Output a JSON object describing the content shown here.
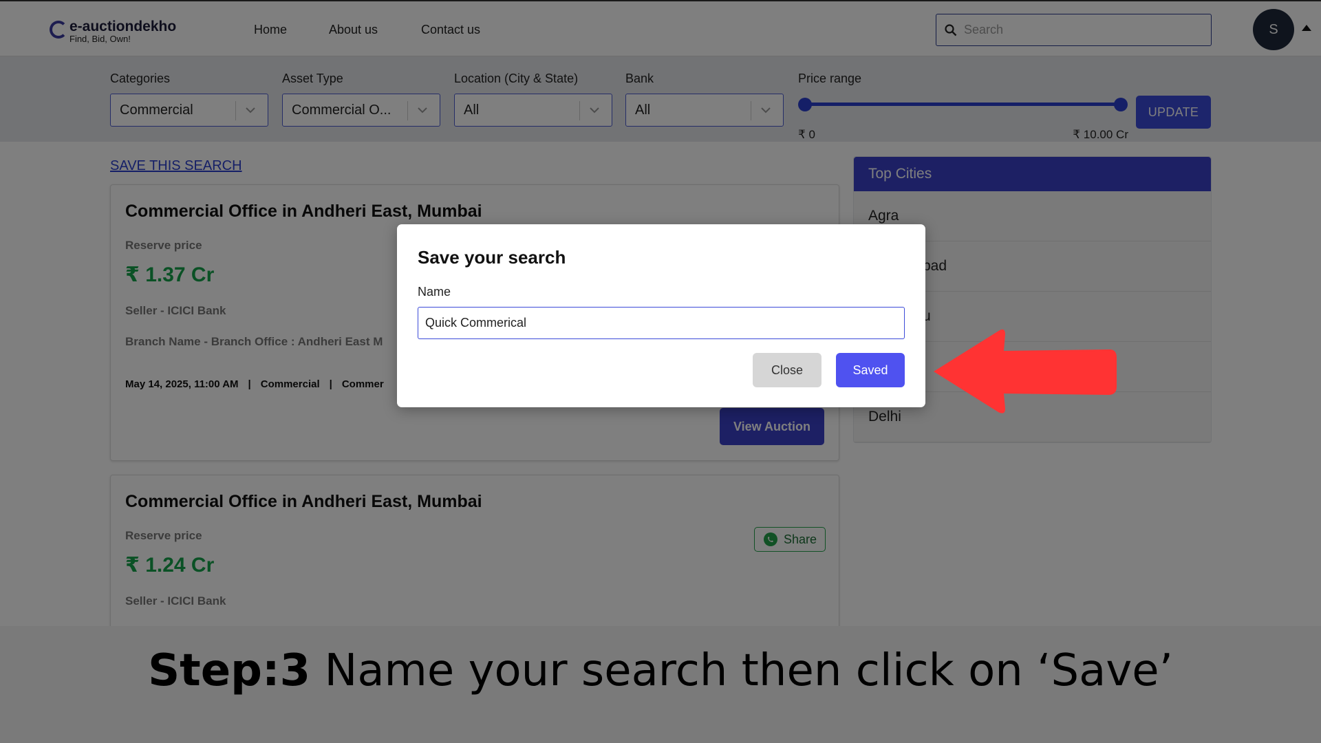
{
  "brand": {
    "name": "e-auctiondekho",
    "tagline": "Find, Bid, Own!"
  },
  "nav": {
    "links": [
      "Home",
      "About us",
      "Contact us"
    ]
  },
  "search": {
    "placeholder": "Search"
  },
  "user": {
    "initial": "S"
  },
  "filters": {
    "categories": {
      "label": "Categories",
      "value": "Commercial"
    },
    "asset_type": {
      "label": "Asset Type",
      "value": "Commercial O..."
    },
    "location": {
      "label": "Location (City & State)",
      "value": "All"
    },
    "bank": {
      "label": "Bank",
      "value": "All"
    },
    "price_range": {
      "label": "Price range",
      "min": "₹ 0",
      "max": "₹ 10.00 Cr",
      "min_fraction": 0,
      "max_fraction": 1
    },
    "update_label": "UPDATE"
  },
  "save_search_link": "SAVE THIS SEARCH",
  "listings": [
    {
      "title": "Commercial Office in Andheri East, Mumbai",
      "reserve_label": "Reserve price",
      "price": "₹ 1.37 Cr",
      "seller": "Seller -  ICICI Bank",
      "branch": "Branch Name -  Branch Office : Andheri East M",
      "date": "May 14, 2025, 11:00 AM",
      "category": "Commercial",
      "asset": "Commer",
      "view_label": "View Auction"
    },
    {
      "title": "Commercial Office in Andheri East, Mumbai",
      "reserve_label": "Reserve price",
      "price": "₹ 1.24 Cr",
      "seller": "Seller -  ICICI Bank",
      "share_label": "Share"
    }
  ],
  "top_cities": {
    "title": "Top Cities",
    "items": [
      "Agra",
      "bad",
      "u",
      "",
      "Delhi"
    ]
  },
  "modal": {
    "title": "Save your search",
    "name_label": "Name",
    "name_value": "Quick Commerical",
    "close_label": "Close",
    "saved_label": "Saved"
  },
  "caption": {
    "step": "Step:3",
    "text": " Name your search then click on ‘Save’"
  },
  "colors": {
    "accent": "#3b40c8",
    "primary_button": "#4f52f0",
    "price_green": "#15a34a",
    "arrow": "#ff3333"
  }
}
